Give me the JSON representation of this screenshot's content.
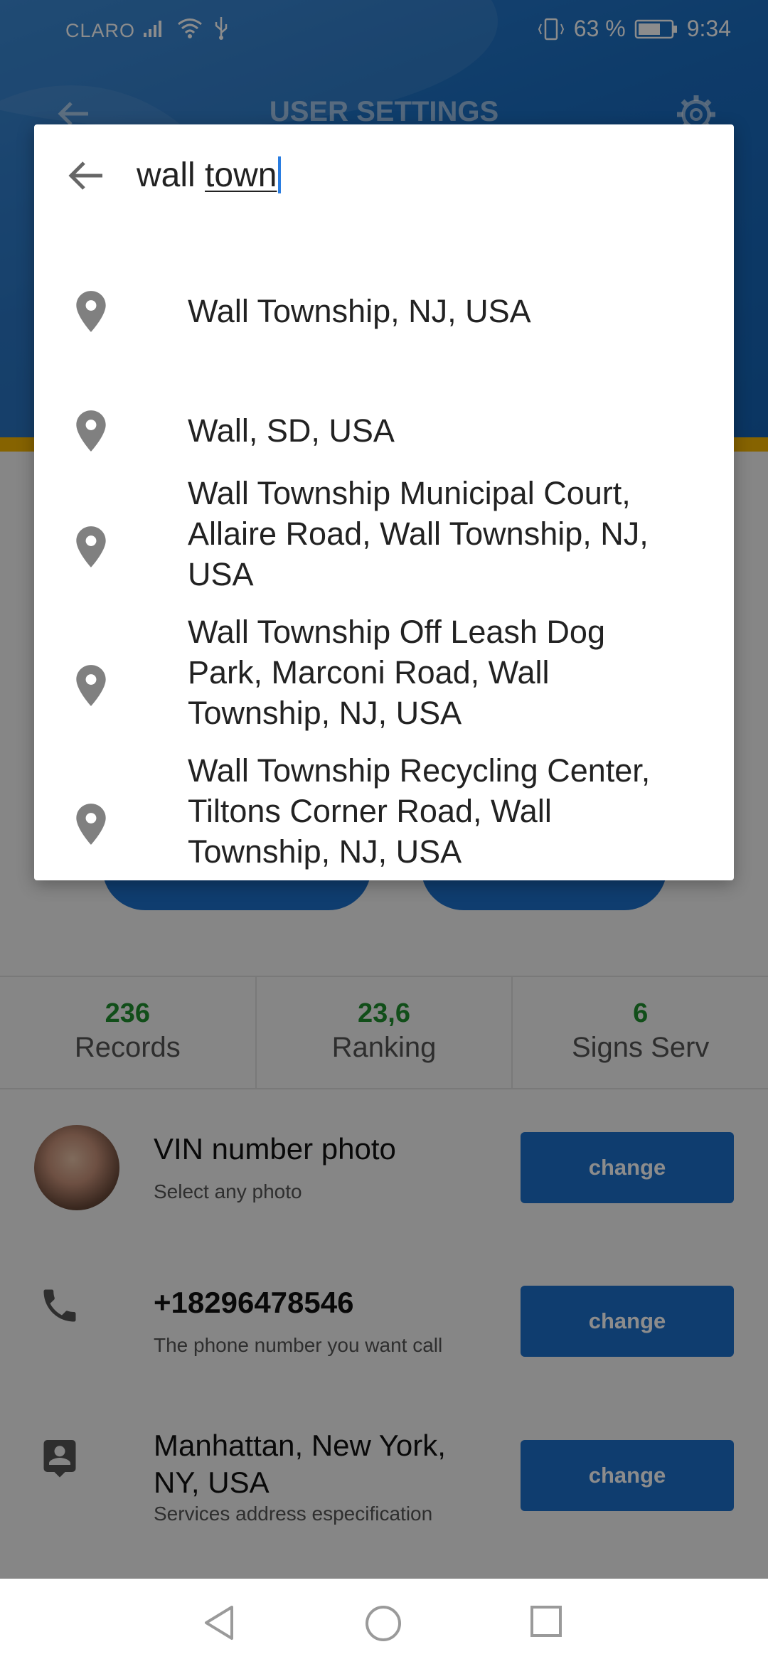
{
  "status_bar": {
    "carrier": "CLARO",
    "battery_percent": "63 %",
    "time": "9:34"
  },
  "app_bar": {
    "title": "USER SETTINGS"
  },
  "stats": [
    {
      "value": "236",
      "label": "Records"
    },
    {
      "value": "23,6",
      "label": "Ranking"
    },
    {
      "value": "6",
      "label": "Signs Serv"
    }
  ],
  "settings": {
    "vin": {
      "title": "VIN number photo",
      "subtitle": "Select any photo",
      "button": "change"
    },
    "phone": {
      "title": "+18296478546",
      "subtitle": "The phone number you want call",
      "button": "change"
    },
    "address": {
      "title_line1": "Manhattan, New York,",
      "title_line2": "NY, USA",
      "subtitle": "Services address especification",
      "button": "change"
    }
  },
  "search": {
    "query_plain": "wall ",
    "query_underlined": "town",
    "results": [
      {
        "line1": "Wall Township, NJ, USA",
        "line2": "",
        "line3": ""
      },
      {
        "line1": "Wall, SD, USA",
        "line2": "",
        "line3": ""
      },
      {
        "line1": "Wall Township Municipal Court,",
        "line2": "Allaire Road, Wall Township, NJ,",
        "line3": "USA"
      },
      {
        "line1": "Wall Township Off Leash Dog",
        "line2": "Park, Marconi Road, Wall",
        "line3": "Township, NJ, USA"
      },
      {
        "line1": "Wall Township Recycling Center,",
        "line2": "Tiltons Corner Road, Wall",
        "line3": "Township, NJ, USA"
      }
    ]
  },
  "icons": {
    "back": "arrow-back-icon",
    "settings": "gear-icon",
    "result": "location-pin-icon",
    "phone": "phone-icon",
    "address": "contact-card-icon",
    "nav_back": "triangle-back-icon",
    "nav_home": "circle-home-icon",
    "nav_recents": "square-recents-icon"
  },
  "colors": {
    "primary": "#1c6fcb",
    "accent_yellow": "#f5b400",
    "stat_green": "#1f8f2e",
    "caret": "#2a7de1"
  }
}
